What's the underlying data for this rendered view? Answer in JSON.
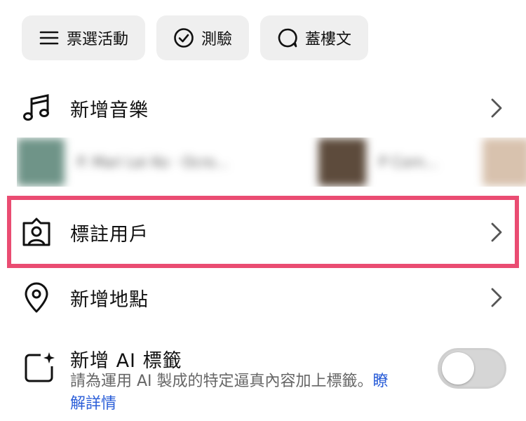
{
  "chips": [
    {
      "label": "票選活動",
      "icon": "list-icon"
    },
    {
      "label": "測驗",
      "icon": "check-circle-icon"
    },
    {
      "label": "蓋樓文",
      "icon": "speech-bubble-icon"
    }
  ],
  "menu": {
    "add_music": {
      "label": "新增音樂",
      "icon": "music-note-icon"
    },
    "tag_people": {
      "label": "標註用戶",
      "icon": "tag-user-icon"
    },
    "add_location": {
      "label": "新增地點",
      "icon": "location-pin-icon"
    }
  },
  "music_suggestions": [
    {
      "title": "P. Mari Lei Ko · Ocro...",
      "thumb_color": "#6f9488"
    },
    {
      "title": "P Corn...",
      "thumb_color": "#5d4b3c"
    },
    {
      "title": "",
      "thumb_color": "#d8c2ae"
    }
  ],
  "ai_label": {
    "title": "新增 AI 標籤",
    "description": "請為運用 AI 製成的特定逼真內容加上標籤。",
    "learn_more": "瞭解詳情",
    "toggle_on": false
  },
  "colors": {
    "highlight_border": "#ea4c72",
    "link": "#2b5ed8",
    "chip_bg": "#efefef"
  }
}
